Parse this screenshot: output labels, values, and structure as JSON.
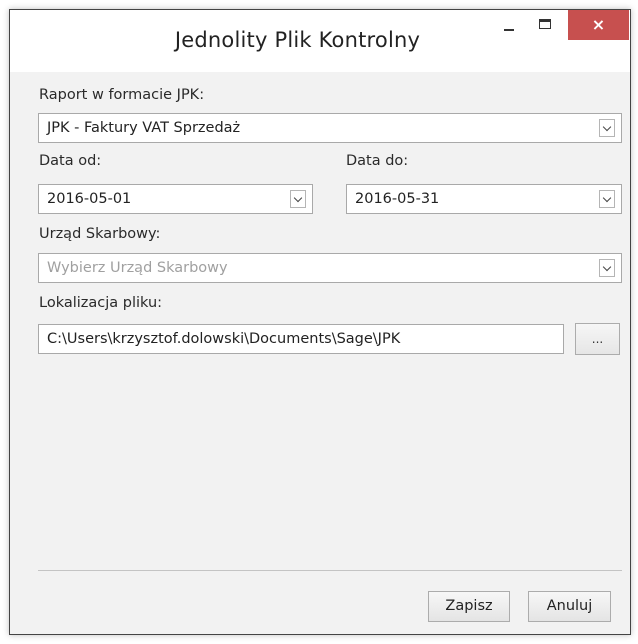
{
  "window": {
    "title": "Jednolity Plik Kontrolny",
    "close_glyph": "×"
  },
  "form": {
    "report_label": "Raport w formacie JPK:",
    "report_value": "JPK - Faktury VAT Sprzedaż",
    "date_from_label": "Data od:",
    "date_from_value": "2016-05-01",
    "date_to_label": "Data do:",
    "date_to_value": "2016-05-31",
    "tax_office_label": "Urząd Skarbowy:",
    "tax_office_placeholder": "Wybierz Urząd Skarbowy",
    "location_label": "Lokalizacja pliku:",
    "location_value": "C:\\Users\\krzysztof.dolowski\\Documents\\Sage\\JPK",
    "browse_label": "..."
  },
  "actions": {
    "save_label": "Zapisz",
    "cancel_label": "Anuluj"
  },
  "colors": {
    "close_button": "#c7504f",
    "window_background": "#f2f2f2",
    "titlebar_background": "#ffffff"
  }
}
